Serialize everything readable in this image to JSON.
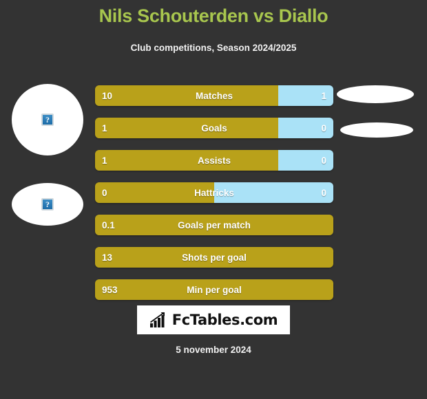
{
  "header": {
    "title": "Nils Schouterden vs Diallo",
    "subtitle": "Club competitions, Season 2024/2025",
    "title_color": "#a8c64e"
  },
  "colors": {
    "background": "#333333",
    "bar_left": "#b9a11a",
    "bar_right": "#aae2f7",
    "text": "#ffffff"
  },
  "avatars": {
    "left": [
      {
        "name": "player-one-photo",
        "icon": "broken-image-icon",
        "glyph": "?"
      },
      {
        "name": "player-two-photo",
        "icon": "broken-image-icon",
        "glyph": "?"
      }
    ],
    "right": [
      {
        "name": "opponent-one-photo"
      },
      {
        "name": "opponent-two-photo"
      }
    ]
  },
  "chart_data": {
    "type": "bar",
    "title": "Nils Schouterden vs Diallo",
    "subtitle": "Club competitions, Season 2024/2025",
    "orientation": "horizontal-diverging",
    "series": [
      {
        "name": "Nils Schouterden",
        "color": "#b9a11a"
      },
      {
        "name": "Diallo",
        "color": "#aae2f7"
      }
    ],
    "categories": [
      "Matches",
      "Goals",
      "Assists",
      "Hattricks",
      "Goals per match",
      "Shots per goal",
      "Min per goal"
    ],
    "rows": [
      {
        "label": "Matches",
        "left": "10",
        "right": "1",
        "left_pct": 77,
        "right_pct": 23,
        "has_right": true
      },
      {
        "label": "Goals",
        "left": "1",
        "right": "0",
        "left_pct": 77,
        "right_pct": 23,
        "has_right": true
      },
      {
        "label": "Assists",
        "left": "1",
        "right": "0",
        "left_pct": 77,
        "right_pct": 23,
        "has_right": true
      },
      {
        "label": "Hattricks",
        "left": "0",
        "right": "0",
        "left_pct": 50,
        "right_pct": 50,
        "has_right": true
      },
      {
        "label": "Goals per match",
        "left": "0.1",
        "right": "",
        "left_pct": 100,
        "right_pct": 0,
        "has_right": false
      },
      {
        "label": "Shots per goal",
        "left": "13",
        "right": "",
        "left_pct": 100,
        "right_pct": 0,
        "has_right": false
      },
      {
        "label": "Min per goal",
        "left": "953",
        "right": "",
        "left_pct": 100,
        "right_pct": 0,
        "has_right": false
      }
    ]
  },
  "logo": {
    "text": "FcTables.com",
    "icon": "bar-chart-growth-icon"
  },
  "footer": {
    "date": "5 november 2024"
  }
}
